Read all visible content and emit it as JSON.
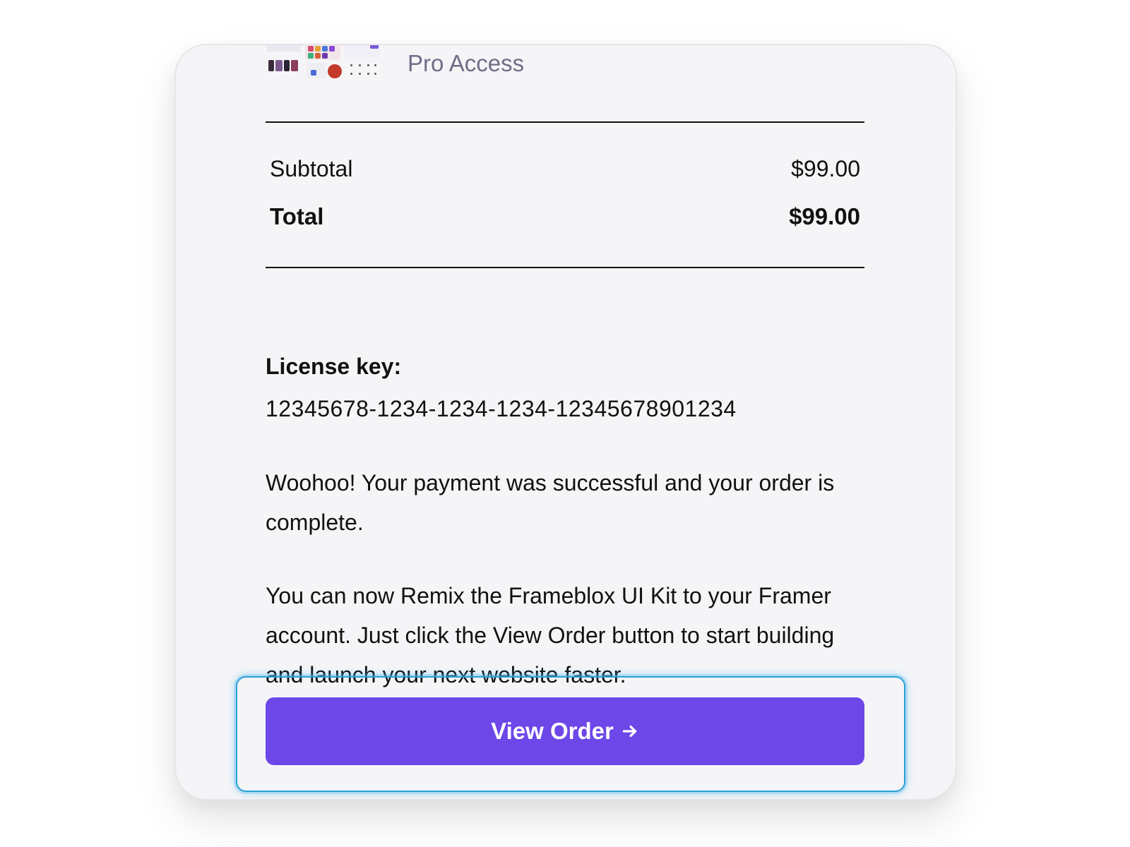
{
  "product": {
    "name": "Pro Access",
    "thumbnail_icon": "product-thumbnail-image"
  },
  "summary": {
    "subtotal_label": "Subtotal",
    "subtotal_value": "$99.00",
    "total_label": "Total",
    "total_value": "$99.00"
  },
  "license": {
    "label": "License key:",
    "value": "12345678-1234-1234-1234-12345678901234"
  },
  "messages": {
    "success": "Woohoo! Your payment was successful and your order is complete.",
    "instructions": "You can now Remix the Frameblox UI Kit to your Framer account. Just click the View Order button to start building and launch your next website faster."
  },
  "actions": {
    "view_order_label": "View Order",
    "view_order_icon": "arrow-right-icon"
  },
  "colors": {
    "accent": "#6d47e8",
    "focus_ring": "#2a9fd6",
    "card_background": "#f5f5f8",
    "muted_text": "#6e6e86"
  }
}
